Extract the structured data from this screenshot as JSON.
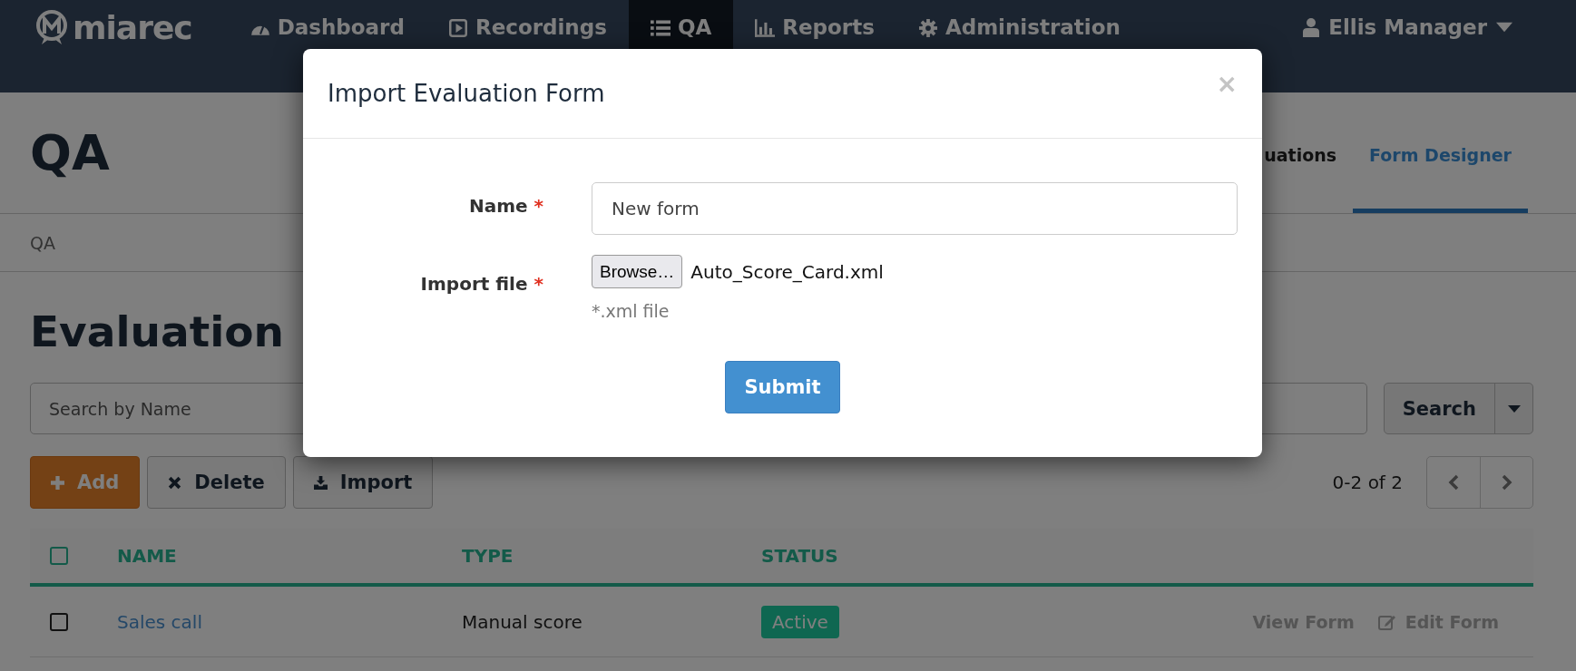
{
  "navbar": {
    "logo": "miarec",
    "items": [
      {
        "label": "Dashboard",
        "selected": false
      },
      {
        "label": "Recordings",
        "selected": false
      },
      {
        "label": "QA",
        "selected": true
      },
      {
        "label": "Reports",
        "selected": false
      },
      {
        "label": "Administration",
        "selected": false
      }
    ],
    "user": "Ellis Manager"
  },
  "page_header": {
    "title": "QA",
    "tabs": [
      {
        "label": "uations",
        "selected": false
      },
      {
        "label": "Form Designer",
        "selected": true
      }
    ]
  },
  "breadcrumb": "QA",
  "section_title": "Evaluation",
  "search": {
    "placeholder": "Search by Name",
    "button": "Search"
  },
  "toolbar": {
    "buttons": [
      {
        "label": "Add",
        "kind": "add"
      },
      {
        "label": "Delete",
        "kind": "delete"
      },
      {
        "label": "Import",
        "kind": "import"
      }
    ],
    "pager": "0-2 of 2"
  },
  "table": {
    "columns": [
      "NAME",
      "TYPE",
      "STATUS"
    ],
    "header_checked": false,
    "rows": [
      {
        "name": "Sales call",
        "type": "Manual score",
        "status": "Active",
        "checked": false,
        "actions": [
          {
            "label": "View Form",
            "kind": "plain"
          },
          {
            "label": "Edit Form",
            "kind": "edit"
          }
        ]
      }
    ]
  },
  "modal": {
    "title": "Import Evaluation Form",
    "close": "×",
    "fields": [
      {
        "label": "Name",
        "marker": "*",
        "kind": "text",
        "value": "New form"
      },
      {
        "label": "Import file",
        "marker": "*",
        "kind": "file",
        "button": "Browse…",
        "value": "Auto_Score_Card.xml",
        "help": "*.xml file"
      }
    ],
    "submit": "Submit"
  }
}
